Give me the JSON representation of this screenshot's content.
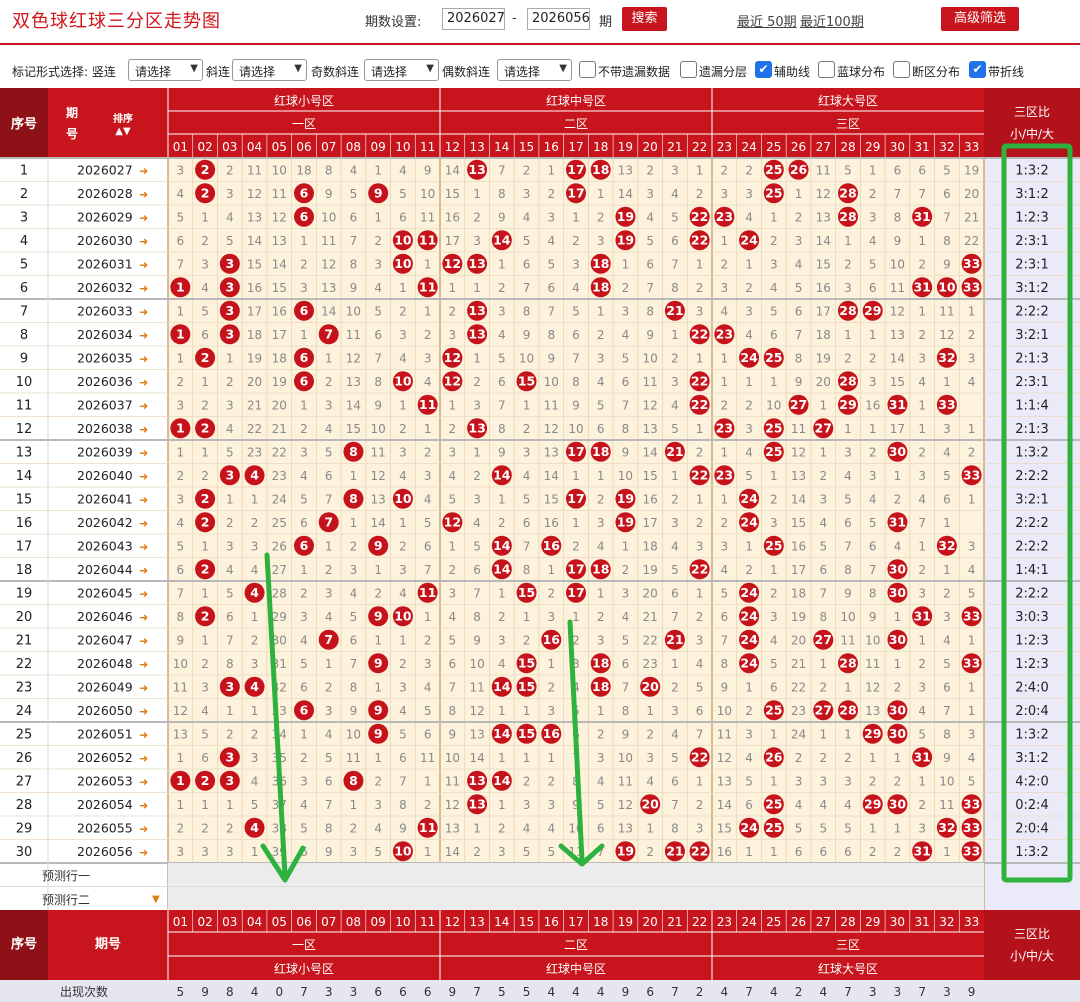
{
  "header": {
    "title": "双色球红球三分区走势图",
    "period_label": "期数设置:",
    "from": "2026027",
    "dash": "-",
    "to": "2026056",
    "period_unit": "期",
    "search": "搜索",
    "recent50": "最近 50期",
    "recent100": "最近100期",
    "advanced": "高级筛选"
  },
  "options": {
    "mark_label": "标记形式选择: 竖连",
    "select_placeholder": "请选择",
    "slant": "斜连",
    "odd_slant": "奇数斜连",
    "even_slant": "偶数斜连",
    "checkboxes": [
      {
        "label": "不带遗漏数据",
        "checked": false
      },
      {
        "label": "遗漏分层",
        "checked": false
      },
      {
        "label": "辅助线",
        "checked": true
      },
      {
        "label": "蓝球分布",
        "checked": false
      },
      {
        "label": "断区分布",
        "checked": false
      },
      {
        "label": "带折线",
        "checked": true
      }
    ]
  },
  "table": {
    "col_seq": "序号",
    "col_period_top": "期",
    "col_period_bottom": "号",
    "col_period": "期号",
    "sort": "排序",
    "zone_groups": [
      "红球小号区",
      "红球中号区",
      "红球大号区"
    ],
    "zone_names": [
      "一区",
      "二区",
      "三区"
    ],
    "ratio_header_1": "三区比",
    "ratio_header_2": "小/中/大",
    "predict_rows": [
      "预测行一",
      "预测行二"
    ],
    "footer_label": "出现次数",
    "footer_counts": [
      5,
      9,
      8,
      4,
      0,
      7,
      3,
      3,
      6,
      6,
      6,
      9,
      7,
      5,
      5,
      4,
      4,
      4,
      9,
      6,
      7,
      2,
      4,
      7,
      4,
      2,
      4,
      7,
      3,
      3,
      7,
      3,
      9
    ],
    "rows": [
      {
        "seq": "1",
        "period": "2026027",
        "cells": [
          3,
          "02",
          2,
          11,
          10,
          18,
          8,
          4,
          1,
          4,
          9,
          14,
          "13",
          7,
          2,
          1,
          "17",
          "18",
          13,
          2,
          3,
          1,
          2,
          2,
          "25",
          "26",
          11,
          5,
          1,
          6,
          6,
          5,
          19
        ],
        "ratio": "1:3:2"
      },
      {
        "seq": "2",
        "period": "2026028",
        "cells": [
          4,
          "02",
          3,
          12,
          11,
          "06",
          9,
          5,
          "09",
          5,
          10,
          15,
          1,
          8,
          3,
          2,
          "17",
          1,
          14,
          3,
          4,
          2,
          3,
          3,
          "25",
          1,
          12,
          "28",
          2,
          7,
          7,
          6,
          20
        ],
        "ratio": "3:1:2"
      },
      {
        "seq": "3",
        "period": "2026029",
        "cells": [
          5,
          1,
          4,
          13,
          12,
          "06",
          10,
          6,
          1,
          6,
          11,
          16,
          2,
          9,
          4,
          3,
          1,
          2,
          "19",
          4,
          5,
          "22",
          "23",
          4,
          1,
          2,
          13,
          "28",
          3,
          8,
          "31",
          7,
          21
        ],
        "ratio": "1:2:3"
      },
      {
        "seq": "4",
        "period": "2026030",
        "cells": [
          6,
          2,
          5,
          14,
          13,
          1,
          11,
          7,
          2,
          "10",
          "11",
          17,
          3,
          "14",
          5,
          4,
          2,
          3,
          "19",
          5,
          6,
          "22",
          1,
          "24",
          2,
          3,
          14,
          1,
          4,
          9,
          1,
          8,
          22
        ],
        "ratio": "2:3:1"
      },
      {
        "seq": "5",
        "period": "2026031",
        "cells": [
          7,
          3,
          "03",
          15,
          14,
          2,
          12,
          8,
          3,
          "10",
          1,
          "12",
          "13",
          1,
          6,
          5,
          3,
          "18",
          1,
          6,
          7,
          1,
          2,
          1,
          3,
          4,
          15,
          2,
          5,
          10,
          2,
          9,
          "33"
        ],
        "ratio": "2:3:1"
      },
      {
        "seq": "6",
        "period": "2026032",
        "cells": [
          "01",
          4,
          "03",
          16,
          15,
          3,
          13,
          9,
          4,
          1,
          "11",
          1,
          1,
          2,
          7,
          6,
          4,
          "18",
          2,
          7,
          8,
          2,
          3,
          2,
          4,
          5,
          16,
          3,
          6,
          11,
          "31",
          "10",
          "33"
        ],
        "ratio": "3:1:2"
      },
      {
        "seq": "7",
        "period": "2026033",
        "cells": [
          1,
          5,
          "03",
          17,
          16,
          "06",
          14,
          10,
          5,
          2,
          1,
          2,
          "13",
          3,
          8,
          7,
          5,
          1,
          3,
          8,
          "21",
          3,
          4,
          3,
          5,
          6,
          17,
          "28",
          "29",
          12,
          1,
          11,
          1
        ],
        "ratio": "2:2:2"
      },
      {
        "seq": "8",
        "period": "2026034",
        "cells": [
          "01",
          6,
          "03",
          18,
          17,
          1,
          "07",
          11,
          6,
          3,
          2,
          3,
          "13",
          4,
          9,
          8,
          6,
          2,
          4,
          9,
          1,
          "22",
          "23",
          4,
          6,
          7,
          18,
          1,
          1,
          13,
          2,
          12,
          2
        ],
        "ratio": "3:2:1"
      },
      {
        "seq": "9",
        "period": "2026035",
        "cells": [
          1,
          "02",
          1,
          19,
          18,
          "06",
          1,
          12,
          7,
          4,
          3,
          "12",
          1,
          5,
          10,
          9,
          7,
          3,
          5,
          10,
          2,
          1,
          1,
          "24",
          "25",
          8,
          19,
          2,
          2,
          14,
          3,
          "32",
          3
        ],
        "ratio": "2:1:3"
      },
      {
        "seq": "10",
        "period": "2026036",
        "cells": [
          2,
          1,
          2,
          20,
          19,
          "06",
          2,
          13,
          8,
          "10",
          4,
          "12",
          2,
          6,
          "15",
          10,
          8,
          4,
          6,
          11,
          3,
          "22",
          1,
          1,
          1,
          9,
          20,
          "28",
          3,
          15,
          4,
          1,
          4
        ],
        "ratio": "2:3:1"
      },
      {
        "seq": "11",
        "period": "2026037",
        "cells": [
          3,
          2,
          3,
          21,
          20,
          1,
          3,
          14,
          9,
          1,
          "11",
          1,
          3,
          7,
          1,
          11,
          9,
          5,
          7,
          12,
          4,
          "22",
          2,
          2,
          10,
          "27",
          1,
          "29",
          16,
          "31",
          1,
          "33"
        ],
        "ratio": "1:1:4"
      },
      {
        "seq": "12",
        "period": "2026038",
        "cells": [
          "01",
          "02",
          4,
          22,
          21,
          2,
          4,
          15,
          10,
          2,
          1,
          2,
          "13",
          8,
          2,
          12,
          10,
          6,
          8,
          13,
          5,
          1,
          "23",
          3,
          "25",
          11,
          "27",
          1,
          1,
          17,
          1,
          3,
          1
        ],
        "ratio": "2:1:3"
      },
      {
        "seq": "13",
        "period": "2026039",
        "cells": [
          1,
          1,
          5,
          23,
          22,
          3,
          5,
          "08",
          11,
          3,
          2,
          3,
          1,
          9,
          3,
          13,
          "17",
          "18",
          9,
          14,
          "21",
          2,
          1,
          4,
          "25",
          12,
          1,
          3,
          2,
          "30",
          2,
          4,
          2
        ],
        "ratio": "1:3:2"
      },
      {
        "seq": "14",
        "period": "2026040",
        "cells": [
          2,
          2,
          "03",
          "04",
          23,
          4,
          6,
          1,
          12,
          4,
          3,
          4,
          2,
          "14",
          4,
          14,
          1,
          1,
          10,
          15,
          1,
          "22",
          "23",
          5,
          1,
          13,
          2,
          4,
          3,
          1,
          3,
          5,
          "33"
        ],
        "ratio": "2:2:2"
      },
      {
        "seq": "15",
        "period": "2026041",
        "cells": [
          3,
          "02",
          1,
          1,
          24,
          5,
          7,
          "08",
          13,
          "10",
          4,
          5,
          3,
          1,
          5,
          15,
          "17",
          2,
          "19",
          16,
          2,
          1,
          1,
          "24",
          2,
          14,
          3,
          5,
          4,
          2,
          4,
          6,
          1
        ],
        "ratio": "3:2:1"
      },
      {
        "seq": "16",
        "period": "2026042",
        "cells": [
          4,
          "02",
          2,
          2,
          25,
          6,
          "07",
          1,
          14,
          1,
          5,
          "12",
          4,
          2,
          6,
          16,
          1,
          3,
          "19",
          17,
          3,
          2,
          2,
          "24",
          3,
          15,
          4,
          6,
          5,
          "31",
          7,
          1
        ],
        "ratio": "2:2:2"
      },
      {
        "seq": "17",
        "period": "2026043",
        "cells": [
          5,
          1,
          3,
          3,
          26,
          "06",
          1,
          2,
          "09",
          2,
          6,
          1,
          5,
          "14",
          7,
          "16",
          2,
          4,
          1,
          18,
          4,
          3,
          3,
          1,
          "25",
          16,
          5,
          7,
          6,
          4,
          1,
          "32",
          3
        ],
        "ratio": "2:2:2"
      },
      {
        "seq": "18",
        "period": "2026044",
        "cells": [
          6,
          "02",
          4,
          4,
          27,
          1,
          2,
          3,
          1,
          3,
          7,
          2,
          6,
          "14",
          8,
          1,
          "17",
          "18",
          2,
          19,
          5,
          "22",
          4,
          2,
          1,
          17,
          6,
          8,
          7,
          "30",
          2,
          1,
          4
        ],
        "ratio": "1:4:1"
      },
      {
        "seq": "19",
        "period": "2026045",
        "cells": [
          7,
          1,
          5,
          "04",
          28,
          2,
          3,
          4,
          2,
          4,
          "11",
          3,
          7,
          1,
          "15",
          2,
          "17",
          1,
          3,
          20,
          6,
          1,
          5,
          "24",
          2,
          18,
          7,
          9,
          8,
          "30",
          3,
          2,
          5
        ],
        "ratio": "2:2:2"
      },
      {
        "seq": "20",
        "period": "2026046",
        "cells": [
          8,
          "02",
          6,
          1,
          29,
          3,
          4,
          5,
          "09",
          "10",
          1,
          4,
          8,
          2,
          1,
          3,
          1,
          2,
          4,
          21,
          7,
          2,
          6,
          "24",
          3,
          19,
          8,
          10,
          9,
          1,
          "31",
          3,
          "33"
        ],
        "ratio": "3:0:3"
      },
      {
        "seq": "21",
        "period": "2026047",
        "cells": [
          9,
          1,
          7,
          2,
          30,
          4,
          "07",
          6,
          1,
          1,
          2,
          5,
          9,
          3,
          2,
          "16",
          2,
          3,
          5,
          22,
          "21",
          3,
          7,
          "24",
          4,
          20,
          "27",
          11,
          10,
          "30",
          1,
          4,
          1
        ],
        "ratio": "1:2:3"
      },
      {
        "seq": "22",
        "period": "2026048",
        "cells": [
          10,
          2,
          8,
          3,
          31,
          5,
          1,
          7,
          "09",
          2,
          3,
          6,
          10,
          4,
          "15",
          1,
          3,
          "18",
          6,
          23,
          1,
          4,
          8,
          "24",
          5,
          21,
          1,
          "28",
          11,
          1,
          2,
          5,
          "33"
        ],
        "ratio": "1:2:3"
      },
      {
        "seq": "23",
        "period": "2026049",
        "cells": [
          11,
          3,
          "03",
          "04",
          32,
          6,
          2,
          8,
          1,
          3,
          4,
          7,
          11,
          "14",
          "15",
          2,
          4,
          "18",
          7,
          "20",
          2,
          5,
          9,
          1,
          6,
          22,
          2,
          1,
          12,
          2,
          3,
          6,
          1
        ],
        "ratio": "2:4:0"
      },
      {
        "seq": "24",
        "period": "2026050",
        "cells": [
          12,
          4,
          1,
          1,
          33,
          "06",
          3,
          9,
          "09",
          4,
          5,
          8,
          12,
          1,
          1,
          3,
          5,
          1,
          8,
          1,
          3,
          6,
          10,
          2,
          "25",
          23,
          "27",
          "28",
          13,
          "30",
          4,
          7,
          1
        ],
        "ratio": "2:0:4"
      },
      {
        "seq": "25",
        "period": "2026051",
        "cells": [
          13,
          5,
          2,
          2,
          34,
          1,
          4,
          10,
          "09",
          5,
          6,
          9,
          13,
          "14",
          "15",
          "16",
          6,
          2,
          9,
          2,
          4,
          7,
          11,
          3,
          1,
          24,
          1,
          1,
          "29",
          "30",
          5,
          8,
          3
        ],
        "ratio": "1:3:2"
      },
      {
        "seq": "26",
        "period": "2026052",
        "cells": [
          1,
          6,
          "03",
          3,
          35,
          2,
          5,
          11,
          1,
          6,
          11,
          10,
          14,
          1,
          1,
          1,
          7,
          3,
          10,
          3,
          5,
          "22",
          12,
          4,
          "26",
          2,
          2,
          2,
          1,
          1,
          "31",
          9,
          4
        ],
        "ratio": "3:1:2"
      },
      {
        "seq": "27",
        "period": "2026053",
        "cells": [
          "01",
          "02",
          "03",
          4,
          36,
          3,
          6,
          "08",
          2,
          7,
          1,
          11,
          "13",
          "14",
          2,
          2,
          8,
          4,
          11,
          4,
          6,
          1,
          13,
          5,
          1,
          3,
          3,
          3,
          2,
          2,
          1,
          10,
          5
        ],
        "ratio": "4:2:0"
      },
      {
        "seq": "28",
        "period": "2026054",
        "cells": [
          1,
          1,
          1,
          5,
          37,
          4,
          7,
          1,
          3,
          8,
          2,
          12,
          "13",
          1,
          3,
          3,
          9,
          5,
          12,
          "20",
          7,
          2,
          14,
          6,
          "25",
          4,
          4,
          4,
          "29",
          "30",
          2,
          11,
          "33"
        ],
        "ratio": "0:2:4"
      },
      {
        "seq": "29",
        "period": "2026055",
        "cells": [
          2,
          2,
          2,
          "04",
          38,
          5,
          8,
          2,
          4,
          9,
          "11",
          13,
          1,
          2,
          4,
          4,
          10,
          6,
          13,
          1,
          8,
          3,
          15,
          "24",
          "25",
          5,
          5,
          5,
          1,
          1,
          3,
          "32",
          "33"
        ],
        "ratio": "2:0:4"
      },
      {
        "seq": "30",
        "period": "2026056",
        "cells": [
          3,
          3,
          3,
          1,
          39,
          6,
          9,
          3,
          5,
          "10",
          1,
          14,
          2,
          3,
          5,
          5,
          11,
          7,
          "19",
          2,
          "21",
          "22",
          16,
          1,
          1,
          6,
          6,
          6,
          2,
          2,
          "31",
          1,
          "33"
        ],
        "ratio": "1:3:2"
      }
    ]
  },
  "colors": {
    "brand_red": "#c8141c",
    "ball_red": "#c6131b",
    "checkbox_blue": "#1e73e8",
    "annotation_green": "#2db33d",
    "row_bg": "#fdf2dc",
    "ratio_bg": "#eaeaf8"
  },
  "icons": [
    "period-arrow-icon",
    "sort-icon",
    "checkmark-icon",
    "dropdown-arrow-icon"
  ]
}
